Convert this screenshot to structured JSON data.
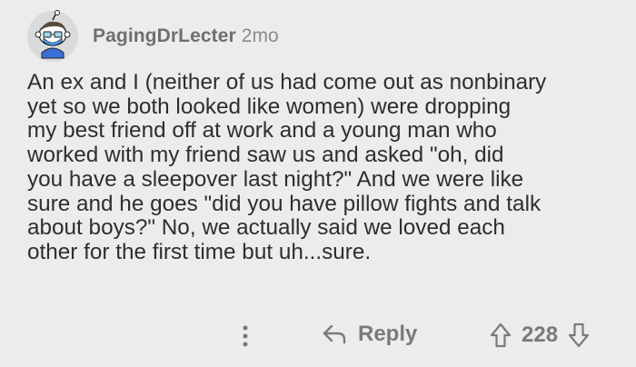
{
  "comment": {
    "username": "PagingDrLecter",
    "age": "2mo",
    "avatar_icon": "snoo-avatar-icon",
    "body": "An ex and I (neither of us had come out as nonbinary\nyet so we both looked like women) were dropping\nmy best friend off at work and a young man who\nworked with my friend saw us and asked \"oh, did\nyou have a sleepover last night?\" And we were like\nsure and he goes \"did you have pillow fights and talk\nabout boys?\" No, we actually said we loved each\nother for the first time but uh...sure.",
    "actions": {
      "more_icon": "more-options-icon",
      "reply_icon": "reply-arrow-icon",
      "reply_label": "Reply",
      "upvote_icon": "upvote-arrow-icon",
      "score": "228",
      "downvote_icon": "downvote-arrow-icon"
    }
  },
  "colors": {
    "background": "#ececec",
    "text": "#2e2e2e",
    "muted": "#7a7a7a"
  }
}
